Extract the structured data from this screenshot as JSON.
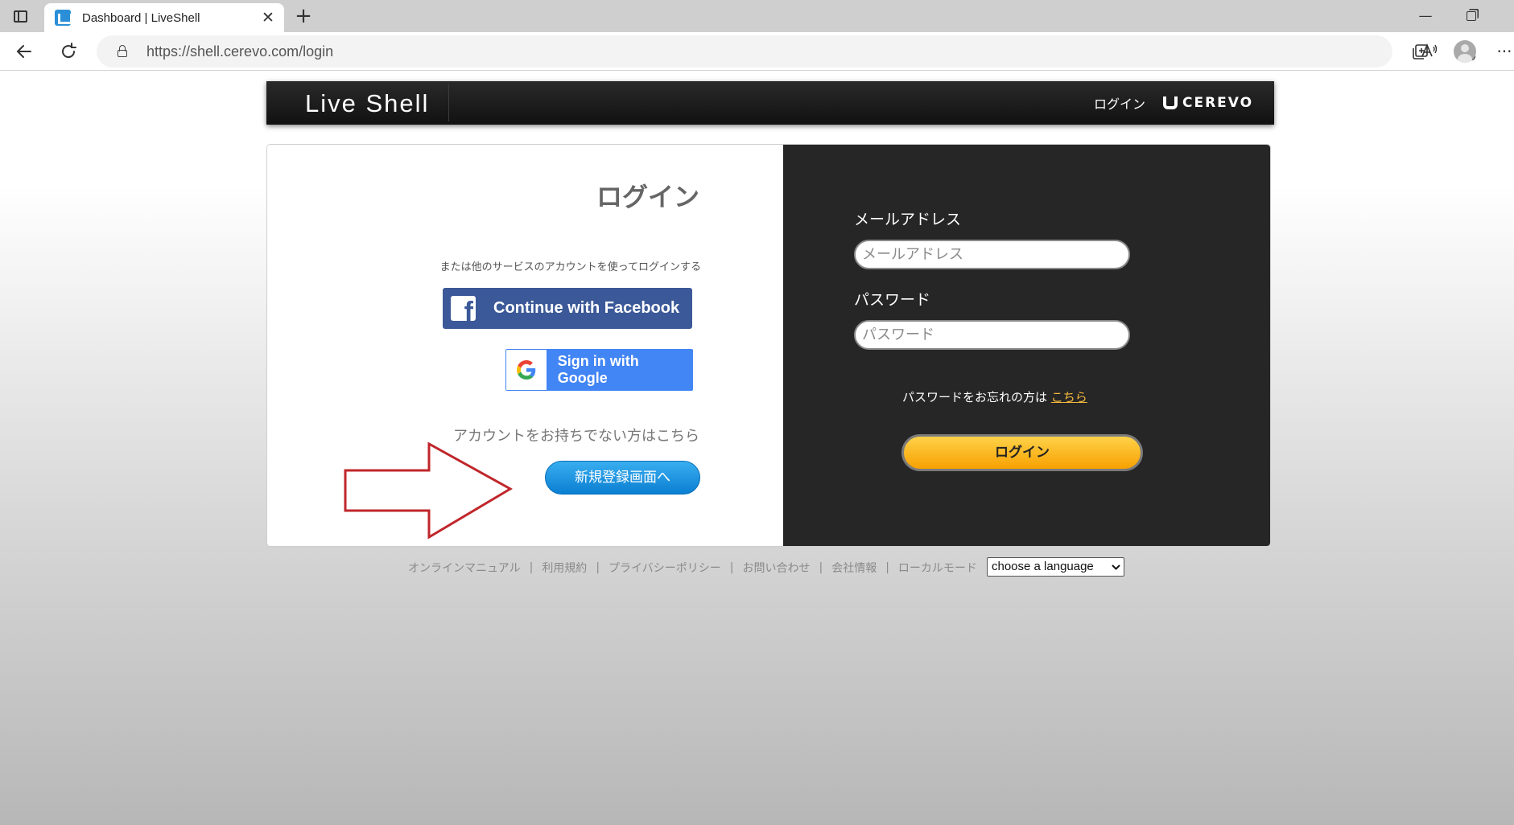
{
  "browser": {
    "tab_title": "Dashboard | LiveShell",
    "tab_close": "✕",
    "new_tab": "+",
    "url": "https://shell.cerevo.com/login",
    "min": "—",
    "more": "···"
  },
  "header": {
    "logo": "Live Shell",
    "login_link": "ログイン",
    "brand": "CEREVO"
  },
  "left_panel": {
    "heading": "ログイン",
    "alt_login_text": "または他のサービスのアカウントを使ってログインする",
    "facebook_label": "Continue with Facebook",
    "google_label": "Sign in with Google",
    "no_account_text": "アカウントをお持ちでない方はこちら",
    "register_label": "新規登録画面へ"
  },
  "right_panel": {
    "email_label": "メールアドレス",
    "email_placeholder": "メールアドレス",
    "password_label": "パスワード",
    "password_placeholder": "パスワード",
    "forgot_text": "パスワードをお忘れの方は",
    "forgot_link": "こちら",
    "login_button": "ログイン"
  },
  "footer": {
    "links": [
      "オンラインマニュアル",
      "利用規約",
      "プライバシーポリシー",
      "お問い合わせ",
      "会社情報",
      "ローカルモード"
    ],
    "separator": "|",
    "language_select": "choose a language"
  },
  "colors": {
    "facebook": "#3b5998",
    "google": "#4285f4",
    "register": "#0a7fd2",
    "login_button": "#f7a100",
    "forgot_link": "#f5b83d",
    "annotation_arrow": "#c0262b"
  }
}
